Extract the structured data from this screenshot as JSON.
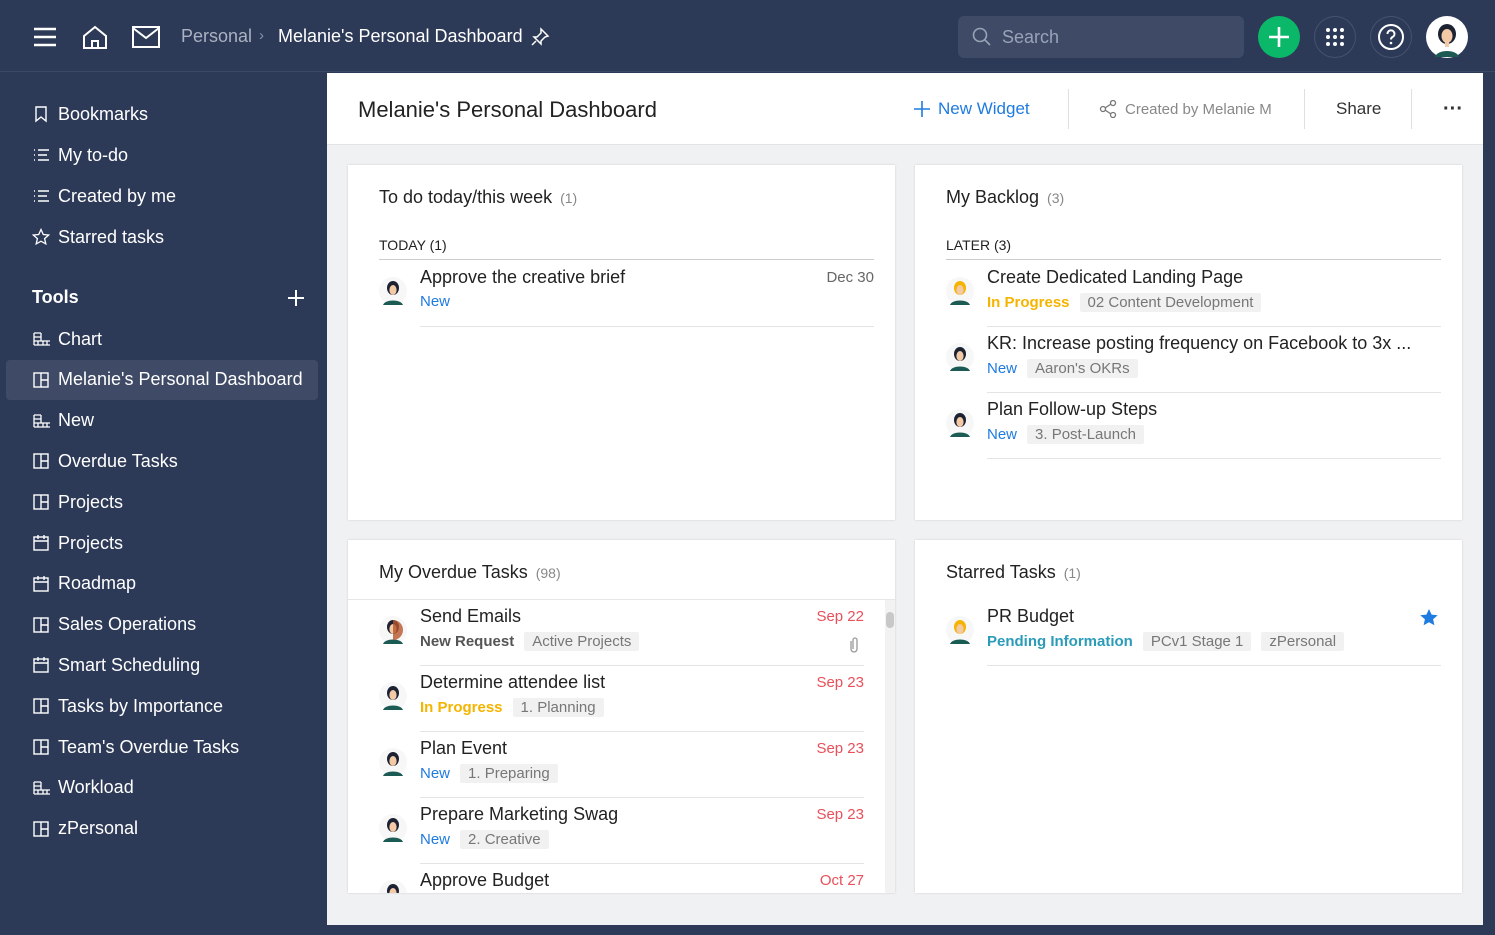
{
  "topbar": {
    "breadcrumb_parent": "Personal",
    "breadcrumb_current": "Melanie's Personal Dashboard",
    "search_placeholder": "Search"
  },
  "sidebar": {
    "top_items": [
      {
        "label": "Bookmarks",
        "icon": "bookmark"
      },
      {
        "label": "My to-do",
        "icon": "list"
      },
      {
        "label": "Created by me",
        "icon": "list"
      },
      {
        "label": "Starred tasks",
        "icon": "star"
      }
    ],
    "tools_label": "Tools",
    "tools": [
      {
        "label": "Chart",
        "icon": "table"
      },
      {
        "label": "Melanie's Personal Dashboard",
        "icon": "board",
        "active": true
      },
      {
        "label": "New",
        "icon": "table"
      },
      {
        "label": "Overdue Tasks",
        "icon": "board"
      },
      {
        "label": "Projects",
        "icon": "board"
      },
      {
        "label": "Projects",
        "icon": "calendar"
      },
      {
        "label": "Roadmap",
        "icon": "calendar"
      },
      {
        "label": "Sales Operations",
        "icon": "board"
      },
      {
        "label": "Smart Scheduling",
        "icon": "calendar"
      },
      {
        "label": "Tasks by Importance",
        "icon": "board"
      },
      {
        "label": "Team's Overdue Tasks",
        "icon": "board"
      },
      {
        "label": "Workload",
        "icon": "table"
      },
      {
        "label": "zPersonal",
        "icon": "board"
      }
    ]
  },
  "header": {
    "title": "Melanie's Personal Dashboard",
    "new_widget": "New Widget",
    "created_by": "Created by Melanie M",
    "share": "Share"
  },
  "widgets": {
    "todo": {
      "title": "To do today/this week",
      "count": "(1)",
      "section": "TODAY (1)",
      "tasks": [
        {
          "title": "Approve the creative brief",
          "status": "New",
          "status_class": "st-new",
          "tags": [],
          "date": "Dec 30",
          "date_color": "#666"
        }
      ]
    },
    "backlog": {
      "title": "My Backlog",
      "count": "(3)",
      "section": "LATER (3)",
      "tasks": [
        {
          "title": "Create Dedicated Landing Page",
          "status": "In Progress",
          "status_class": "st-prog",
          "tags": [
            "02 Content Development"
          ]
        },
        {
          "title": "KR: Increase posting frequency on Facebook to 3x ...",
          "status": "New",
          "status_class": "st-new",
          "tags": [
            "Aaron's OKRs"
          ]
        },
        {
          "title": "Plan Follow-up Steps",
          "status": "New",
          "status_class": "st-new",
          "tags": [
            "3. Post-Launch"
          ]
        }
      ]
    },
    "overdue": {
      "title": "My Overdue Tasks",
      "count": "(98)",
      "tasks": [
        {
          "title": "Send Emails",
          "status": "New Request",
          "status_class": "st-req",
          "tags": [
            "Active Projects"
          ],
          "date": "Sep 22",
          "date_color": "#e8505b",
          "attachment": true
        },
        {
          "title": "Determine attendee list",
          "status": "In Progress",
          "status_class": "st-prog",
          "tags": [
            "1. Planning"
          ],
          "date": "Sep 23",
          "date_color": "#e8505b"
        },
        {
          "title": "Plan Event",
          "status": "New",
          "status_class": "st-new",
          "tags": [
            "1. Preparing"
          ],
          "date": "Sep 23",
          "date_color": "#e8505b"
        },
        {
          "title": "Prepare Marketing Swag",
          "status": "New",
          "status_class": "st-new",
          "tags": [
            "2. Creative"
          ],
          "date": "Sep 23",
          "date_color": "#e8505b"
        },
        {
          "title": "Approve Budget",
          "status": "",
          "status_class": "",
          "tags": [],
          "date": "Oct 27",
          "date_color": "#e8505b"
        }
      ]
    },
    "starred": {
      "title": "Starred Tasks",
      "count": "(1)",
      "tasks": [
        {
          "title": "PR Budget",
          "status": "Pending Information",
          "status_class": "st-pend",
          "tags": [
            "PCv1 Stage 1",
            "zPersonal"
          ],
          "starred": true
        }
      ]
    }
  },
  "colors": {
    "nav": "#2d3a57",
    "accent": "#1e7be0",
    "add": "#0bb86a",
    "overdue": "#e8505b",
    "in_progress": "#f5b400"
  }
}
